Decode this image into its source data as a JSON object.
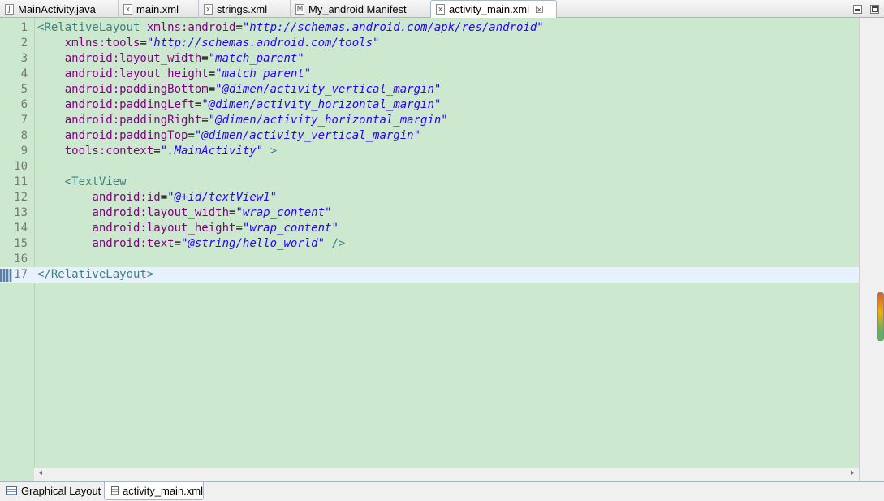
{
  "tabs": [
    {
      "label": "MainActivity.java",
      "icon": "java-file-icon",
      "active": false
    },
    {
      "label": "main.xml",
      "icon": "xml-file-icon",
      "active": false
    },
    {
      "label": "strings.xml",
      "icon": "xml-file-icon",
      "active": false
    },
    {
      "label": "My_android Manifest",
      "icon": "manifest-file-icon",
      "active": false
    },
    {
      "label": "activity_main.xml",
      "icon": "xml-file-icon",
      "active": true,
      "close": "☒"
    }
  ],
  "editor": {
    "current_line": 17,
    "line_numbers": [
      "1",
      "2",
      "3",
      "4",
      "5",
      "6",
      "7",
      "8",
      "9",
      "10",
      "11",
      "12",
      "13",
      "14",
      "15",
      "16",
      "17"
    ],
    "lines": [
      [
        [
          "tg",
          "<RelativeLayout "
        ],
        [
          "at",
          "xmlns:android"
        ],
        [
          "pl",
          "="
        ],
        [
          "val",
          "\"http://schemas.android.com/apk/res/android\""
        ]
      ],
      [
        [
          "pl",
          "    "
        ],
        [
          "at",
          "xmlns:tools"
        ],
        [
          "pl",
          "="
        ],
        [
          "val",
          "\"http://schemas.android.com/tools\""
        ]
      ],
      [
        [
          "pl",
          "    "
        ],
        [
          "at",
          "android:layout_width"
        ],
        [
          "pl",
          "="
        ],
        [
          "val",
          "\"match_parent\""
        ]
      ],
      [
        [
          "pl",
          "    "
        ],
        [
          "at",
          "android:layout_height"
        ],
        [
          "pl",
          "="
        ],
        [
          "val",
          "\"match_parent\""
        ]
      ],
      [
        [
          "pl",
          "    "
        ],
        [
          "at",
          "android:paddingBottom"
        ],
        [
          "pl",
          "="
        ],
        [
          "val",
          "\"@dimen/activity_vertical_margin\""
        ]
      ],
      [
        [
          "pl",
          "    "
        ],
        [
          "at",
          "android:paddingLeft"
        ],
        [
          "pl",
          "="
        ],
        [
          "val",
          "\"@dimen/activity_horizontal_margin\""
        ]
      ],
      [
        [
          "pl",
          "    "
        ],
        [
          "at",
          "android:paddingRight"
        ],
        [
          "pl",
          "="
        ],
        [
          "val",
          "\"@dimen/activity_horizontal_margin\""
        ]
      ],
      [
        [
          "pl",
          "    "
        ],
        [
          "at",
          "android:paddingTop"
        ],
        [
          "pl",
          "="
        ],
        [
          "val",
          "\"@dimen/activity_vertical_margin\""
        ]
      ],
      [
        [
          "pl",
          "    "
        ],
        [
          "at",
          "tools:context"
        ],
        [
          "pl",
          "="
        ],
        [
          "val",
          "\".MainActivity\""
        ],
        [
          "tg",
          " >"
        ]
      ],
      [],
      [
        [
          "pl",
          "    "
        ],
        [
          "tg",
          "<TextView"
        ]
      ],
      [
        [
          "pl",
          "        "
        ],
        [
          "at",
          "android:id"
        ],
        [
          "pl",
          "="
        ],
        [
          "val",
          "\"@+id/textView1\""
        ]
      ],
      [
        [
          "pl",
          "        "
        ],
        [
          "at",
          "android:layout_width"
        ],
        [
          "pl",
          "="
        ],
        [
          "val",
          "\"wrap_content\""
        ]
      ],
      [
        [
          "pl",
          "        "
        ],
        [
          "at",
          "android:layout_height"
        ],
        [
          "pl",
          "="
        ],
        [
          "val",
          "\"wrap_content\""
        ]
      ],
      [
        [
          "pl",
          "        "
        ],
        [
          "at",
          "android:text"
        ],
        [
          "pl",
          "="
        ],
        [
          "val",
          "\"@string/hello_world\""
        ],
        [
          "tg",
          " />"
        ]
      ],
      [],
      [
        [
          "tg",
          "</RelativeLayout>"
        ]
      ]
    ]
  },
  "bottom_tabs": [
    {
      "label": "Graphical Layout",
      "active": false
    },
    {
      "label": "activity_main.xml",
      "active": true
    }
  ],
  "colors": {
    "editor_bg": "#cce8cf",
    "current_line_bg": "#e8f2fe",
    "tag": "#3f7f7f",
    "attribute": "#7f007f",
    "value": "#2a00ff"
  }
}
